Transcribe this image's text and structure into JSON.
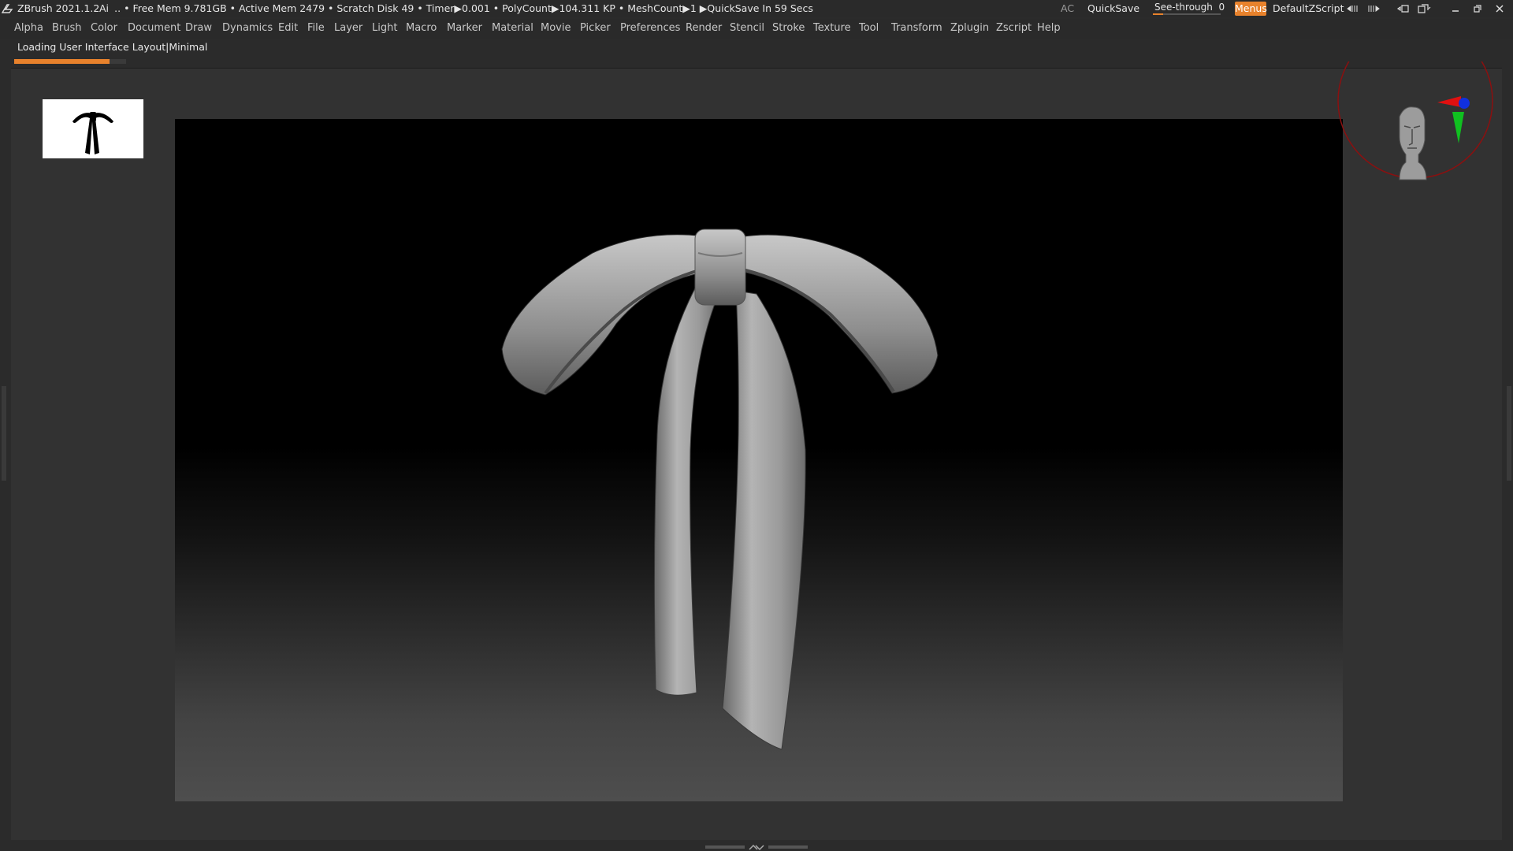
{
  "titlebar": {
    "app": "ZBrush 2021.1.2",
    "ai": "Ai",
    "stats": "․. • Free Mem 9.781GB • Active Mem 2479 • Scratch Disk 49 •  Timer▶0.001 • PolyCount▶104.311 KP  • MeshCount▶1   ▶QuickSave In 59 Secs",
    "ac": "AC",
    "quicksave": "QuickSave",
    "seethrough_label": "See-through",
    "seethrough_value": "0",
    "seethrough_level": 0.15,
    "menus": "Menus",
    "script": "DefaultZScript"
  },
  "menubar": {
    "items": [
      "Alpha",
      "Brush",
      "Color",
      "Document",
      "Draw",
      "Dynamics",
      "Edit",
      "File",
      "Layer",
      "Light",
      "Macro",
      "Marker",
      "Material",
      "Movie",
      "Picker",
      "Preferences",
      "Render",
      "Stencil",
      "Stroke",
      "Texture",
      "Tool",
      "Transform",
      "Zplugin",
      "Zscript",
      "Help"
    ]
  },
  "notice": "Loading User Interface Layout|Minimal",
  "loading_progress": 0.85,
  "colors": {
    "accent": "#e8822c",
    "background": "#2b2b2b",
    "gizmo_x": "#e01010",
    "gizmo_y": "#10c020",
    "gizmo_z": "#1030e0"
  },
  "icons": [
    "zbrush-logo-icon",
    "minimize-icon",
    "maximize-icon",
    "close-icon",
    "layout-icon",
    "navigation-head-icon"
  ]
}
